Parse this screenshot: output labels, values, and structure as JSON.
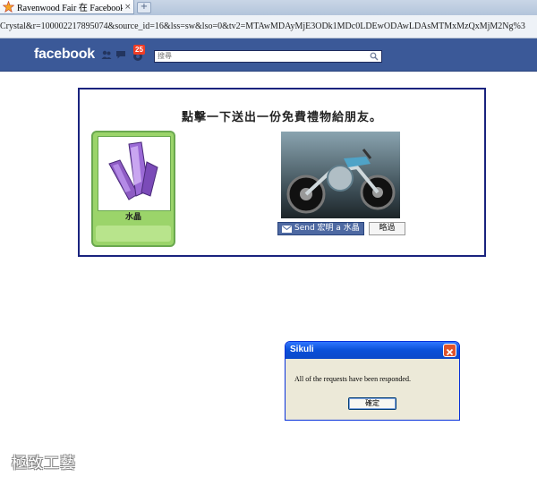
{
  "browser": {
    "tab_title": "Ravenwood Fair 在 Facebook",
    "tab_close": "×",
    "new_tab": "+",
    "url": "Crystal&r=100002217895074&source_id=16&lss=sw&lso=0&tv2=MTAwMDAyMjE3ODk1MDc0LDEwODAwLDAsMTMxMzQxMjM2Ng%3"
  },
  "facebook": {
    "logo": "facebook",
    "notification_count": "25",
    "search_placeholder": "搜尋"
  },
  "gift": {
    "prompt": "點擊一下送出一份免費禮物給朋友。",
    "item_label": "水晶",
    "send_label": "Send 宏明 a 水晶",
    "skip_label": "略過"
  },
  "dialog": {
    "title": "Sikuli",
    "message": "All of the requests have been responded.",
    "ok_label": "確定"
  },
  "watermark": "極致工藝",
  "colors": {
    "facebook_blue": "#3b5998",
    "panel_border": "#1a237e",
    "card_green": "#9bd46a",
    "xp_titlebar": "#0a4fd8"
  }
}
